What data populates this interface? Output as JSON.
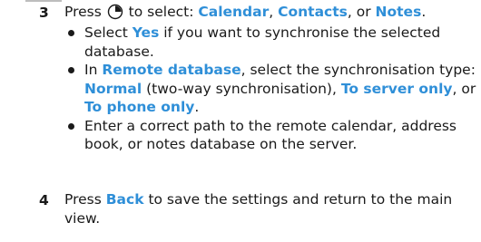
{
  "step3": {
    "number": "3",
    "prefix": "Press ",
    "joystick_icon": "joystick-press-icon",
    "middle": " to select: ",
    "opt1": "Calendar",
    "sep1": ", ",
    "opt2": "Contacts",
    "sep2": ", or ",
    "opt3": "Notes",
    "end": "."
  },
  "bullets": {
    "b1": {
      "pre": "Select ",
      "hl1": "Yes",
      "post": " if you want to synchronise the selected database."
    },
    "b2": {
      "pre": "In ",
      "hl1": "Remote database",
      "mid1": ", select the synchronisation type: ",
      "hl2": "Normal",
      "mid2": " (two-way synchronisation), ",
      "hl3": "To server only",
      "mid3": ", or ",
      "hl4": "To phone only",
      "post": "."
    },
    "b3": {
      "text": "Enter a correct path to the remote calendar, address book, or notes database on the server."
    }
  },
  "step4": {
    "number": "4",
    "prefix": "Press ",
    "hl": "Back",
    "post": " to save the settings and return to the main view."
  }
}
